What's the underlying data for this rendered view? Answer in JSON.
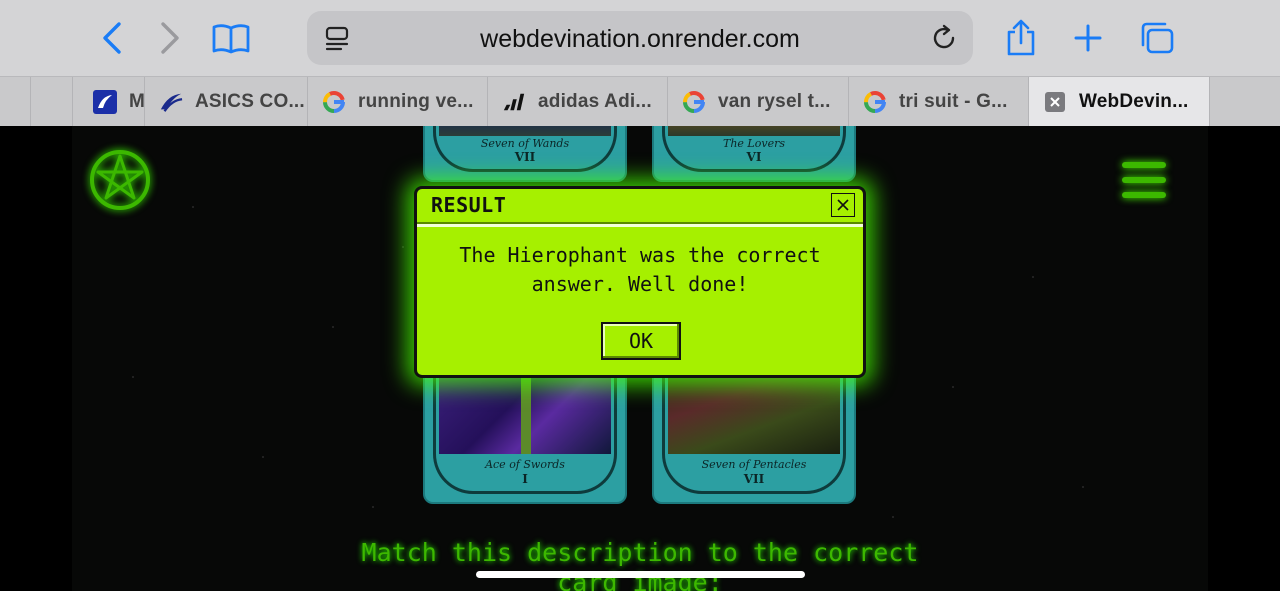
{
  "browser": {
    "url": "webdevination.onrender.com",
    "tabs": [
      {
        "title": "M",
        "favicon": "mizuno-icon"
      },
      {
        "title": "ASICS CO...",
        "favicon": "asics-icon"
      },
      {
        "title": "running ve...",
        "favicon": "google-icon"
      },
      {
        "title": "adidas Adi...",
        "favicon": "adidas-icon"
      },
      {
        "title": "van rysel t...",
        "favicon": "google-icon"
      },
      {
        "title": "tri suit - G...",
        "favicon": "google-icon"
      },
      {
        "title": "WebDevin...",
        "favicon": "close-tab-icon"
      }
    ]
  },
  "cards": {
    "top_left": {
      "name": "Seven of Wands",
      "number": "VII"
    },
    "top_right": {
      "name": "The Lovers",
      "number": "VI"
    },
    "bottom_left": {
      "name": "Ace of Swords",
      "number": "I"
    },
    "bottom_right": {
      "name": "Seven of Pentacles",
      "number": "VII"
    }
  },
  "description": {
    "line1": "Match this description to the correct",
    "line2": "card image:"
  },
  "modal": {
    "title": "RESULT",
    "message_line1": "The Hierophant was the correct",
    "message_line2": "answer. Well done!",
    "ok_label": "OK"
  },
  "colors": {
    "accent_green": "#a6f000",
    "glow_green": "#3cff00",
    "card_teal": "#2c9fa2",
    "ios_blue": "#1a7cf6"
  }
}
